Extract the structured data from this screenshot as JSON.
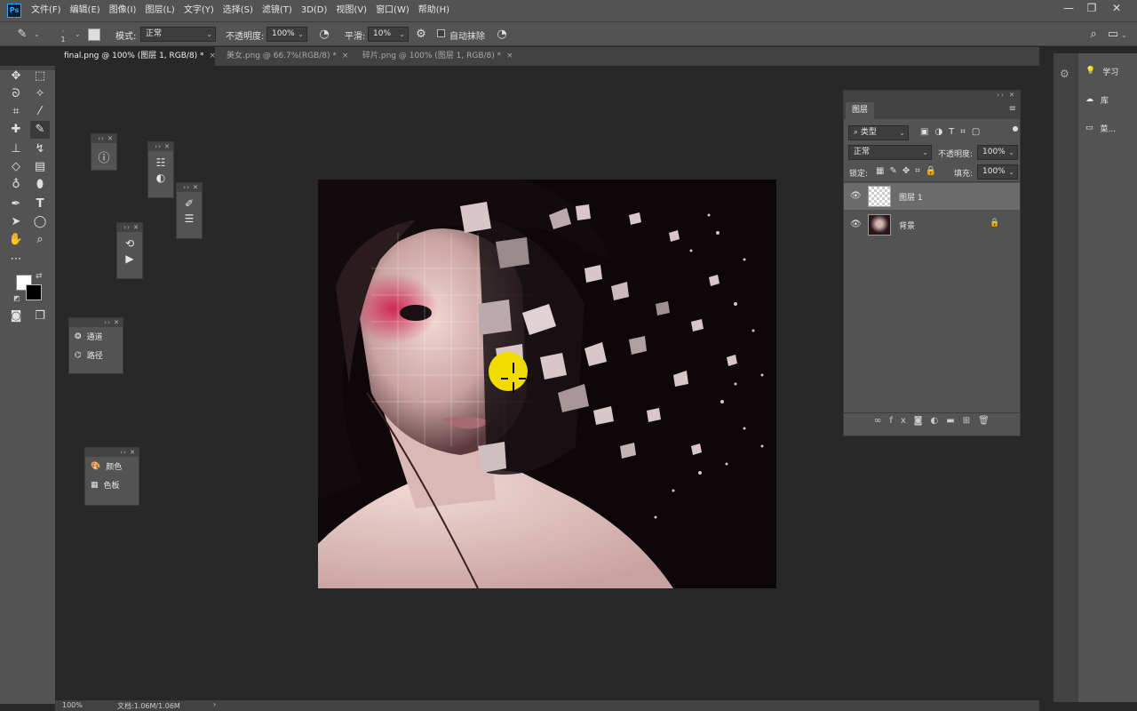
{
  "app": {
    "logo": "Ps",
    "menus": [
      "文件(F)",
      "编辑(E)",
      "图像(I)",
      "图层(L)",
      "文字(Y)",
      "选择(S)",
      "滤镜(T)",
      "3D(D)",
      "视图(V)",
      "窗口(W)",
      "帮助(H)"
    ],
    "window_controls": {
      "minimize": "—",
      "restore": "❐",
      "close": "✕"
    }
  },
  "options": {
    "brush_size": "1",
    "mode_label": "模式:",
    "mode_value": "正常",
    "opacity_label": "不透明度:",
    "opacity_value": "100%",
    "smooth_label": "平滑:",
    "smooth_value": "10%",
    "auto_erase_label": "自动抹除"
  },
  "tabs": [
    {
      "label": "final.png @ 100% (图层 1, RGB/8) *",
      "close": "×",
      "active": true
    },
    {
      "label": "美女.png @ 66.7%(RGB/8) *",
      "close": "×",
      "active": false
    },
    {
      "label": "碎片.png @ 100% (图层 1, RGB/8) *",
      "close": "×",
      "active": false
    }
  ],
  "floating_panels": {
    "channels_label": "通道",
    "paths_label": "路径",
    "color_label": "颜色",
    "swatches_label": "色板"
  },
  "layers_panel": {
    "tab": "图层",
    "filter_kind": "类型",
    "blend_mode": "正常",
    "opacity_label": "不透明度:",
    "opacity_value": "100%",
    "lock_label": "锁定:",
    "fill_label": "填充:",
    "fill_value": "100%",
    "layers": [
      {
        "name": "图层 1",
        "selected": true,
        "visible": true
      },
      {
        "name": "背景",
        "selected": false,
        "visible": true,
        "locked": true
      }
    ]
  },
  "dock": {
    "learn": "学习",
    "libraries": "库",
    "third": "菜..."
  },
  "status": {
    "zoom": "100%",
    "doc_info": "文档:1.06M/1.06M",
    "arrow": "›"
  },
  "colors": {
    "ui_dark": "#282828",
    "ui_panel": "#535353",
    "ui_header": "#424242",
    "accent_blue": "#31a8ff",
    "cursor_yellow": "#f2dc00"
  }
}
